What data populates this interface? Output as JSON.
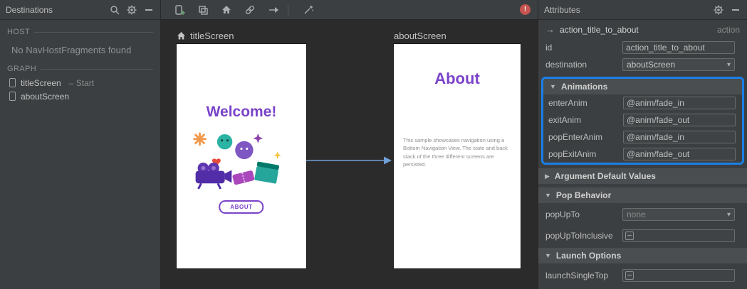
{
  "glyphs": {
    "collapse_open": "▼",
    "collapse_closed": "▶",
    "dropdown_arrow": "▾",
    "checkbox_dash": "–",
    "error": "!",
    "action_arrow": "→"
  },
  "left_panel": {
    "title": "Destinations",
    "host": {
      "label": "HOST",
      "message": "No NavHostFragments found"
    },
    "graph": {
      "label": "GRAPH",
      "items": [
        {
          "name": "titleScreen",
          "suffix": "– Start"
        },
        {
          "name": "aboutScreen",
          "suffix": ""
        }
      ]
    }
  },
  "canvas": {
    "screens": [
      {
        "label": "titleScreen"
      },
      {
        "label": "aboutScreen"
      }
    ],
    "title_screen": {
      "heading": "Welcome!",
      "button_label": "ABOUT"
    },
    "about_screen": {
      "heading": "About",
      "body": "This sample showcases navigation using a Bottom Navigation View. The state and back stack of the three different screens are persisted."
    }
  },
  "attributes": {
    "title": "Attributes",
    "action": {
      "name": "action_title_to_about",
      "type": "action"
    },
    "id_field": {
      "label": "id",
      "value": "action_title_to_about"
    },
    "destination_field": {
      "label": "destination",
      "value": "aboutScreen"
    },
    "animations": {
      "header": "Animations",
      "fields": [
        {
          "label": "enterAnim",
          "value": "@anim/fade_in"
        },
        {
          "label": "exitAnim",
          "value": "@anim/fade_out"
        },
        {
          "label": "popEnterAnim",
          "value": "@anim/fade_in"
        },
        {
          "label": "popExitAnim",
          "value": "@anim/fade_out"
        }
      ]
    },
    "argument_defaults": {
      "header": "Argument Default Values"
    },
    "pop_behavior": {
      "header": "Pop Behavior",
      "pop_up_to": {
        "label": "popUpTo",
        "value": "none"
      },
      "pop_up_to_inclusive": {
        "label": "popUpToInclusive"
      }
    },
    "launch_options": {
      "header": "Launch Options",
      "launch_single_top": {
        "label": "launchSingleTop"
      }
    }
  }
}
